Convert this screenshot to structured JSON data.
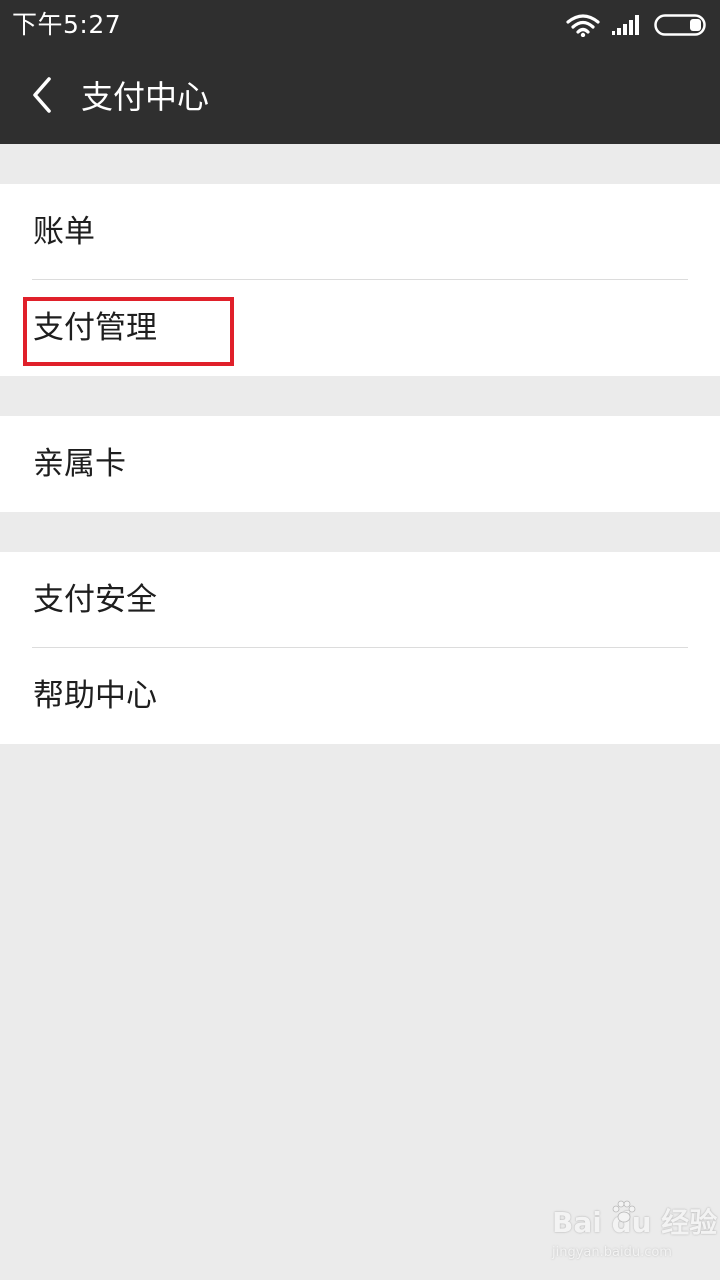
{
  "status_bar": {
    "time": "下午5:27",
    "icons": [
      "wifi-icon",
      "signal-icon",
      "battery-icon"
    ]
  },
  "app_bar": {
    "title": "支付中心",
    "back_icon": "back-arrow-icon"
  },
  "groups": [
    {
      "items": [
        {
          "label": "账单"
        },
        {
          "label": "支付管理",
          "highlighted": true
        }
      ]
    },
    {
      "items": [
        {
          "label": "亲属卡"
        }
      ]
    },
    {
      "items": [
        {
          "label": "支付安全"
        },
        {
          "label": "帮助中心"
        }
      ]
    }
  ],
  "watermark": {
    "logo_text": "Bai du 经验",
    "url": "jingyan.baidu.com"
  },
  "colors": {
    "header_bg": "#2f2f2f",
    "page_bg": "#ebebeb",
    "item_bg": "#ffffff",
    "highlight": "#e0202a"
  }
}
